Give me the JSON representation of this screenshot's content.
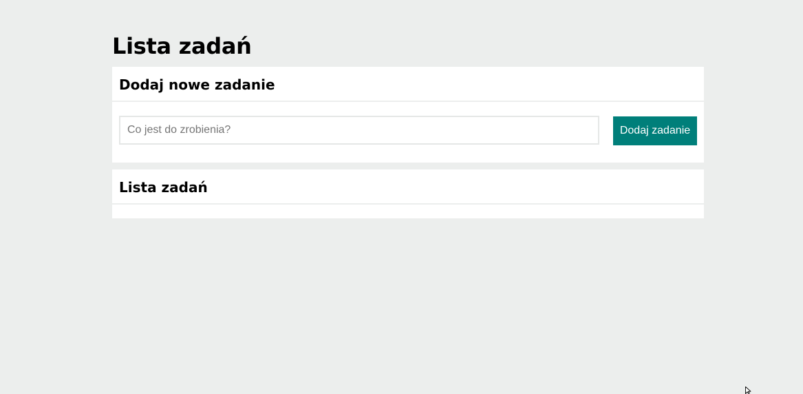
{
  "page": {
    "title": "Lista zadań"
  },
  "add_task_panel": {
    "heading": "Dodaj nowe zadanie",
    "input_placeholder": "Co jest do zrobienia?",
    "input_value": "",
    "button_label": "Dodaj zadanie"
  },
  "task_list_panel": {
    "heading": "Lista zadań",
    "items": []
  },
  "colors": {
    "background": "#eceeed",
    "card": "#ffffff",
    "accent_button": "#007f7a",
    "button_text": "#ffffff"
  },
  "icons": {
    "cursor": "mouse-pointer-icon"
  }
}
